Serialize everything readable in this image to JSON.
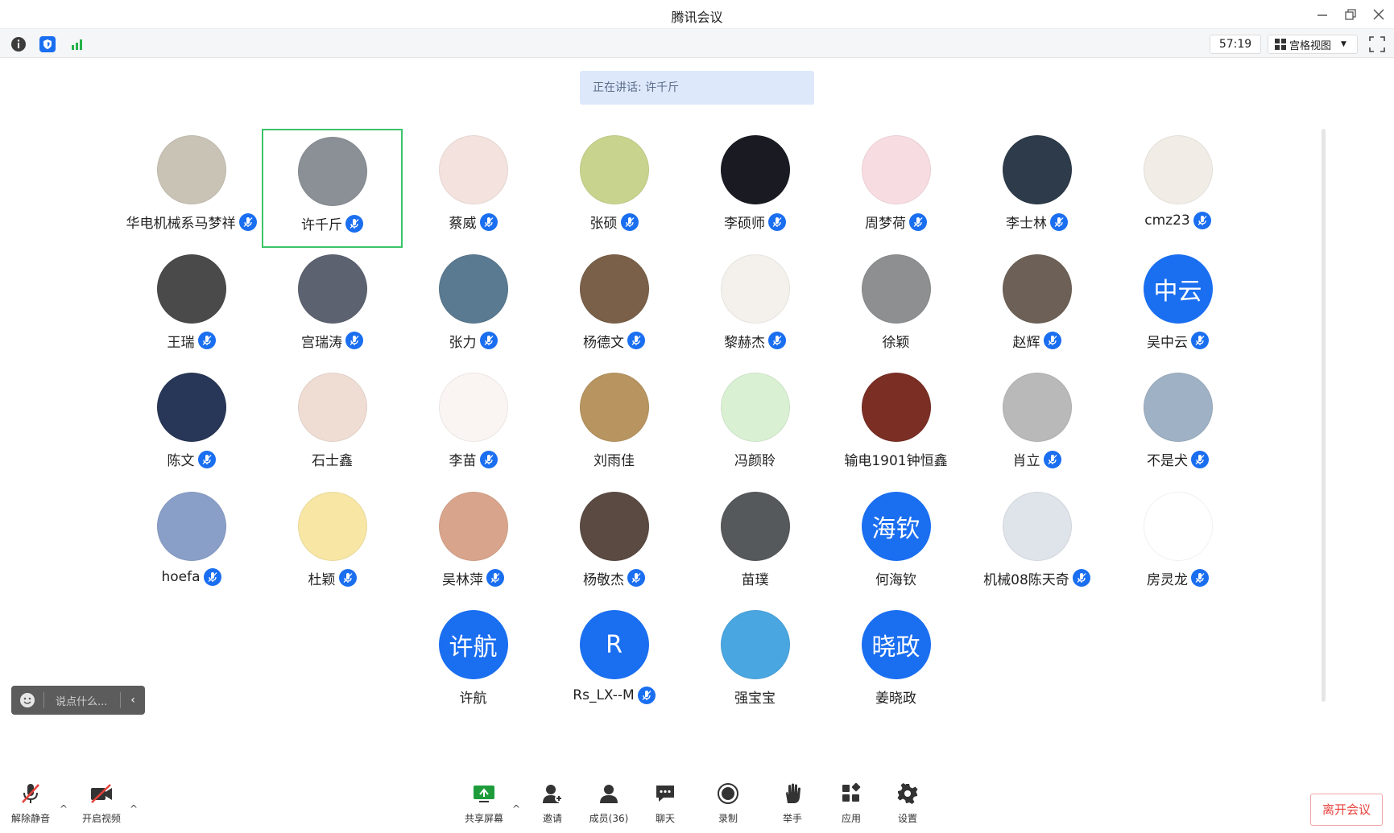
{
  "window": {
    "title": "腾讯会议"
  },
  "toolbar": {
    "timer": "57:19",
    "view_label": "宫格视图"
  },
  "banner": {
    "speaking": "正在讲话: 许千斤"
  },
  "chat": {
    "placeholder": "说点什么..."
  },
  "participants": [
    {
      "name": "华电机械系马梦祥",
      "mic": true,
      "avatar": {
        "type": "image",
        "color": "#c9c3b6"
      }
    },
    {
      "name": "许千斤",
      "mic": true,
      "speaking": true,
      "avatar": {
        "type": "image",
        "color": "#8a9096"
      }
    },
    {
      "name": "蔡威",
      "mic": true,
      "avatar": {
        "type": "image",
        "color": "#f3e2dd"
      }
    },
    {
      "name": "张硕",
      "mic": true,
      "avatar": {
        "type": "image",
        "color": "#c8d48e"
      }
    },
    {
      "name": "李硕师",
      "mic": true,
      "avatar": {
        "type": "image",
        "color": "#1a1b22"
      }
    },
    {
      "name": "周梦荷",
      "mic": true,
      "avatar": {
        "type": "image",
        "color": "#f7dce1"
      }
    },
    {
      "name": "李士林",
      "mic": true,
      "avatar": {
        "type": "image",
        "color": "#2d3b4a"
      }
    },
    {
      "name": "cmz23",
      "mic": true,
      "avatar": {
        "type": "image",
        "color": "#f1ede6"
      }
    },
    {
      "name": "王瑞",
      "mic": true,
      "avatar": {
        "type": "image",
        "color": "#4a4a4a"
      }
    },
    {
      "name": "宫瑞涛",
      "mic": true,
      "avatar": {
        "type": "image",
        "color": "#5c6270"
      }
    },
    {
      "name": "张力",
      "mic": true,
      "avatar": {
        "type": "image",
        "color": "#5a7a92"
      }
    },
    {
      "name": "杨德文",
      "mic": true,
      "avatar": {
        "type": "image",
        "color": "#7a6048"
      }
    },
    {
      "name": "黎赫杰",
      "mic": true,
      "avatar": {
        "type": "image",
        "color": "#f4f1ec"
      }
    },
    {
      "name": "徐颖",
      "mic": false,
      "avatar": {
        "type": "image",
        "color": "#8d8f90"
      }
    },
    {
      "name": "赵辉",
      "mic": true,
      "avatar": {
        "type": "image",
        "color": "#6d6157"
      }
    },
    {
      "name": "吴中云",
      "mic": true,
      "avatar": {
        "type": "text",
        "text": "中云",
        "color": "#1a6ef0"
      }
    },
    {
      "name": "陈文",
      "mic": true,
      "avatar": {
        "type": "image",
        "color": "#283758"
      }
    },
    {
      "name": "石士鑫",
      "mic": false,
      "avatar": {
        "type": "image",
        "color": "#efdcd3"
      }
    },
    {
      "name": "李苗",
      "mic": true,
      "avatar": {
        "type": "image",
        "color": "#faf4f2"
      }
    },
    {
      "name": "刘雨佳",
      "mic": false,
      "avatar": {
        "type": "image",
        "color": "#b89460"
      }
    },
    {
      "name": "冯颜聆",
      "mic": false,
      "avatar": {
        "type": "image",
        "color": "#d9f0d2"
      }
    },
    {
      "name": "输电1901钟恒鑫",
      "mic": false,
      "avatar": {
        "type": "image",
        "color": "#7a2e24"
      }
    },
    {
      "name": "肖立",
      "mic": true,
      "avatar": {
        "type": "image",
        "color": "#b9b9b9"
      }
    },
    {
      "name": "不是犬",
      "mic": true,
      "avatar": {
        "type": "image",
        "color": "#9fb1c4"
      }
    },
    {
      "name": "hoefa",
      "mic": true,
      "avatar": {
        "type": "image",
        "color": "#8a9fc8"
      }
    },
    {
      "name": "杜颖",
      "mic": true,
      "avatar": {
        "type": "image",
        "color": "#f7e6a4"
      }
    },
    {
      "name": "吴林萍",
      "mic": true,
      "avatar": {
        "type": "image",
        "color": "#d8a58c"
      }
    },
    {
      "name": "杨敬杰",
      "mic": true,
      "avatar": {
        "type": "image",
        "color": "#5b4a42"
      }
    },
    {
      "name": "苗璞",
      "mic": false,
      "avatar": {
        "type": "image",
        "color": "#55595c"
      }
    },
    {
      "name": "何海钦",
      "mic": false,
      "avatar": {
        "type": "text",
        "text": "海钦",
        "color": "#1a6ef0"
      }
    },
    {
      "name": "机械08陈天奇",
      "mic": true,
      "avatar": {
        "type": "image",
        "color": "#dfe3ea"
      }
    },
    {
      "name": "房灵龙",
      "mic": true,
      "avatar": {
        "type": "image",
        "color": "#ffffff"
      }
    },
    {
      "name": "许航",
      "mic": false,
      "avatar": {
        "type": "text",
        "text": "许航",
        "color": "#1a6ef0"
      }
    },
    {
      "name": "Rs_LX--M",
      "mic": true,
      "avatar": {
        "type": "text",
        "text": "R",
        "color": "#1a6ef0"
      }
    },
    {
      "name": "强宝宝",
      "mic": false,
      "avatar": {
        "type": "image",
        "color": "#4aa6e0"
      }
    },
    {
      "name": "姜晓政",
      "mic": false,
      "avatar": {
        "type": "text",
        "text": "晓政",
        "color": "#1a6ef0"
      }
    }
  ],
  "bottombar": {
    "unmute": "解除静音",
    "video": "开启视频",
    "share": "共享屏幕",
    "invite": "邀请",
    "members": "成员(36)",
    "chat": "聊天",
    "record": "录制",
    "raise_hand": "举手",
    "apps": "应用",
    "settings": "设置",
    "leave": "离开会议"
  },
  "colors": {
    "accent": "#1a6ef0",
    "active_border": "#3cc36a",
    "leave_red": "#e8413b"
  }
}
